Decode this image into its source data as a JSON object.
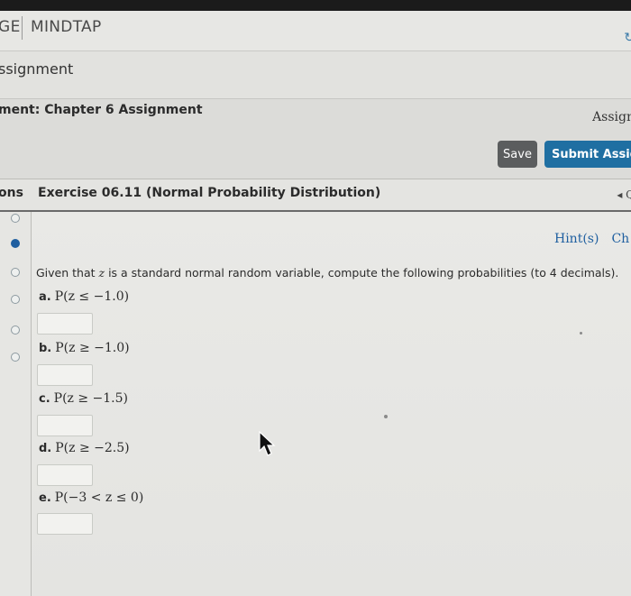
{
  "brand": {
    "left": "GE",
    "right": "MINDTAP"
  },
  "assignment_bar": {
    "title": "ssignment"
  },
  "chapter_bar": {
    "title": "ment: Chapter 6 Assignment",
    "assign_link": "Assign",
    "save": "Save",
    "submit": "Submit Assignm"
  },
  "question_header": {
    "left": "ons",
    "title": "Exercise 06.11 (Normal Probability Distribution)",
    "nav": "◂ Q"
  },
  "content": {
    "hint": "Hint(s)",
    "hint_tail": "Ch",
    "prompt_start": "Given that ",
    "prompt_var": "z",
    "prompt_end": " is a standard normal random variable, compute the following probabilities (to 4 decimals).",
    "parts": [
      {
        "label": "a.",
        "expr": "P(z ≤ −1.0)"
      },
      {
        "label": "b.",
        "expr": "P(z ≥ −1.0)"
      },
      {
        "label": "c.",
        "expr": "P(z ≥ −1.5)"
      },
      {
        "label": "d.",
        "expr": "P(z ≥ −2.5)"
      },
      {
        "label": "e.",
        "expr": "P(−3 < z ≤ 0)"
      }
    ]
  }
}
